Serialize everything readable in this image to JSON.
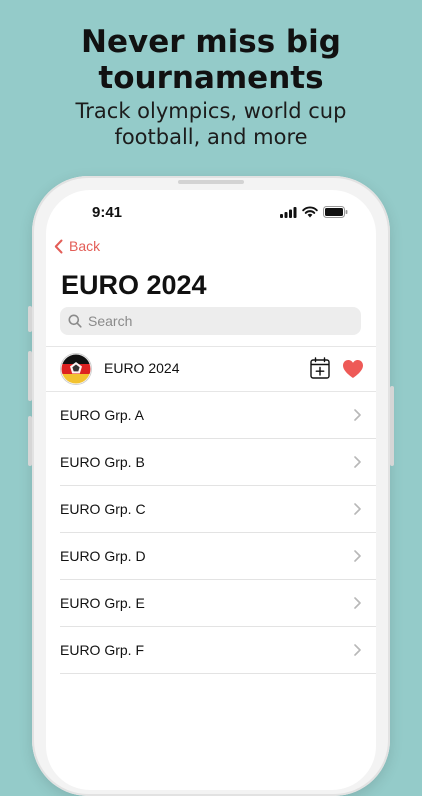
{
  "promo": {
    "headline": "Never miss big tournaments",
    "subline": "Track olympics, world cup football, and more"
  },
  "status_bar": {
    "time": "9:41",
    "icons": [
      "signal-icon",
      "wifi-icon",
      "battery-icon"
    ]
  },
  "nav": {
    "back_label": "Back"
  },
  "page": {
    "title": "EURO 2024"
  },
  "search": {
    "placeholder": "Search",
    "value": ""
  },
  "tournament": {
    "name": "EURO 2024",
    "favorited": true,
    "icons": [
      "euro-logo-icon",
      "add-to-calendar-icon",
      "heart-icon"
    ]
  },
  "groups": [
    {
      "label": "EURO Grp. A"
    },
    {
      "label": "EURO Grp. B"
    },
    {
      "label": "EURO Grp. C"
    },
    {
      "label": "EURO Grp. D"
    },
    {
      "label": "EURO Grp. E"
    },
    {
      "label": "EURO Grp. F"
    }
  ],
  "colors": {
    "background": "#94cbc9",
    "accent": "#e35d57",
    "flag_black": "#111111",
    "flag_red": "#dd2222",
    "flag_gold": "#f2c230"
  }
}
